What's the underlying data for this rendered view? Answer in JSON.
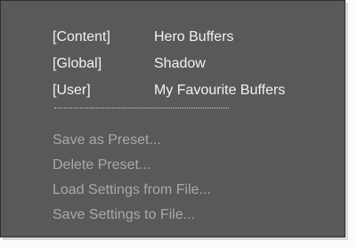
{
  "menu": {
    "presets": [
      {
        "scope": "[Content]",
        "name": "Hero Buffers"
      },
      {
        "scope": "[Global]",
        "name": "Shadow"
      },
      {
        "scope": "[User]",
        "name": "My Favourite Buffers"
      }
    ],
    "actions": [
      {
        "label": "Save as Preset..."
      },
      {
        "label": "Delete Preset..."
      },
      {
        "label": "Load Settings from File..."
      },
      {
        "label": "Save Settings to File..."
      }
    ]
  },
  "colors": {
    "menu_background": "#595959",
    "enabled_text": "#f2f2f2",
    "disabled_text": "#a9a9a9"
  }
}
